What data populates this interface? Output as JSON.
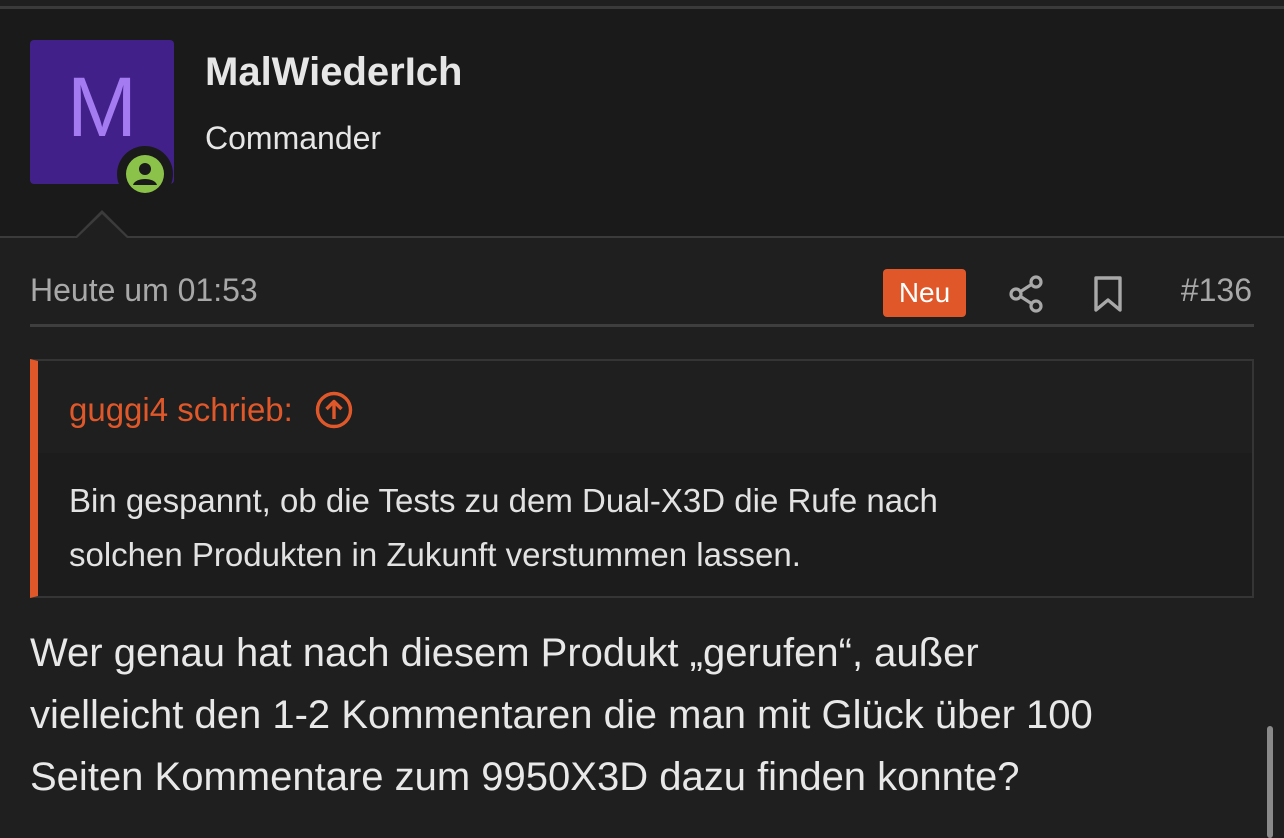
{
  "colors": {
    "accent": "#e0582a",
    "avatar_bg": "#41208a",
    "avatar_letter": "#a47bf0",
    "online": "#8bc34a"
  },
  "author": {
    "avatar_letter": "M",
    "username": "MalWiederIch",
    "title": "Commander",
    "status_icon": "online-user-icon"
  },
  "post": {
    "date": "Heute um 01:53",
    "new_badge": "Neu",
    "share_icon": "share-icon",
    "bookmark_icon": "bookmark-icon",
    "number": "#136"
  },
  "quote": {
    "author_label": "guggi4 schrieb:",
    "jump_icon": "arrow-up-circle-icon",
    "lines": [
      "Bin gespannt, ob die Tests zu dem Dual-X3D die Rufe nach",
      "solchen Produkten in Zukunft verstummen lassen."
    ]
  },
  "body": {
    "lines": [
      "Wer genau hat nach diesem Produkt „gerufen“, außer",
      "vielleicht den 1-2 Kommentaren die man mit Glück über 100",
      "Seiten Kommentare zum 9950X3D dazu finden konnte?"
    ]
  }
}
